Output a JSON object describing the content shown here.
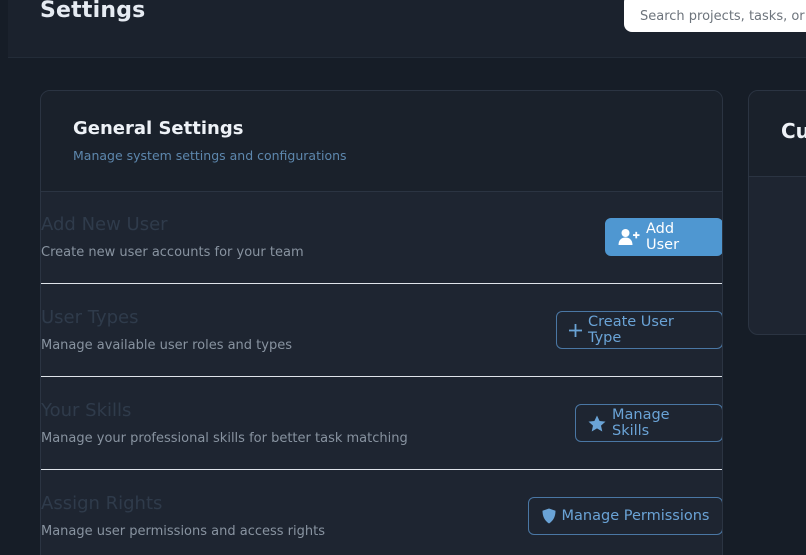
{
  "header": {
    "title": "Settings",
    "search": {
      "placeholder": "Search projects, tasks, or t"
    }
  },
  "general_settings": {
    "title": "General Settings",
    "subtitle": "Manage system settings and configurations",
    "rows": [
      {
        "title": "Add New User",
        "description": "Create new user accounts for your team",
        "button_label": "Add User",
        "button_icon": "user-plus-icon"
      },
      {
        "title": "User Types",
        "description": "Manage available user roles and types",
        "button_label": "Create User Type",
        "button_icon": "plus-icon"
      },
      {
        "title": "Your Skills",
        "description": "Manage your professional skills for better task matching",
        "button_label": "Manage Skills",
        "button_icon": "star-icon"
      },
      {
        "title": "Assign Rights",
        "description": "Manage user permissions and access rights",
        "button_label": "Manage Permissions",
        "button_icon": "shield-icon"
      }
    ]
  },
  "second_card": {
    "title_visible": "Cu"
  },
  "colors": {
    "background": "#161d27",
    "card": "#1e2531",
    "primary_button": "#4f97d1",
    "outline_button_text": "#6aa3d6",
    "subtitle": "#5d87ad"
  }
}
